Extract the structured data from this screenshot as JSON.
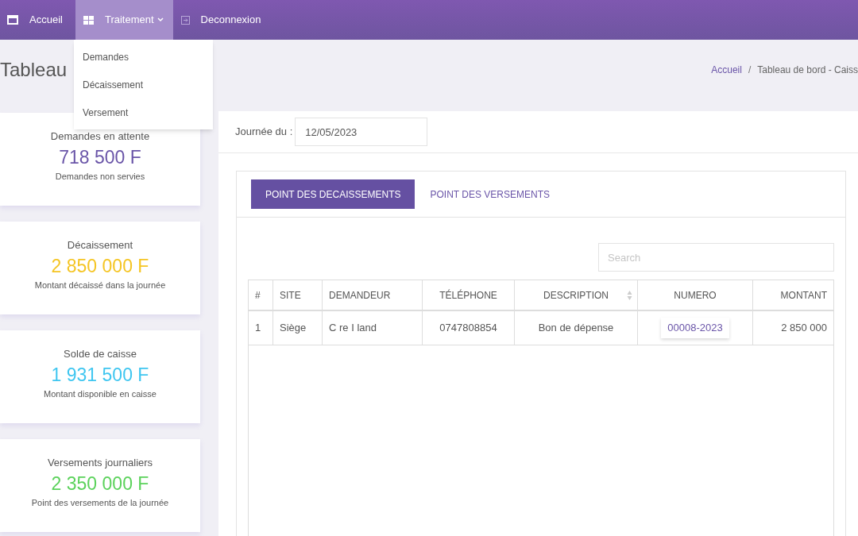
{
  "navbar": {
    "items": [
      {
        "label": "Accueil",
        "selected": false,
        "has_caret": false
      },
      {
        "label": "Traitement",
        "selected": true,
        "has_caret": true
      },
      {
        "label": "Deconnexion",
        "selected": false,
        "has_caret": false
      }
    ]
  },
  "dropdown": {
    "items": [
      "Demandes",
      "Décaissement",
      "Versement"
    ]
  },
  "page_title": "Tableau",
  "breadcrumb": {
    "link": "Accueil",
    "separator": "/",
    "current": "Tableau de bord - Caiss"
  },
  "stats": [
    {
      "title": "Demandes en attente",
      "value": "718 500 F",
      "caption": "Demandes non servies",
      "color": "#6a55a8"
    },
    {
      "title": "Décaissement",
      "value": "2 850 000 F",
      "caption": "Montant décaissé dans la journée",
      "color": "#f5c523"
    },
    {
      "title": "Solde de caisse",
      "value": "1 931 500 F",
      "caption": "Montant disponible en caisse",
      "color": "#3fc6f0"
    },
    {
      "title": "Versements journaliers",
      "value": "2 350 000 F",
      "caption": "Point des versements de la journée",
      "color": "#5bd25b"
    }
  ],
  "date_filter": {
    "label": "Journée du :",
    "value": "12/05/2023"
  },
  "tabs": [
    {
      "label": "POINT DES DECAISSEMENTS",
      "selected": true
    },
    {
      "label": "POINT DES VERSEMENTS",
      "selected": false
    }
  ],
  "search": {
    "placeholder": "Search"
  },
  "table": {
    "columns": [
      {
        "label": "#",
        "sortable": false
      },
      {
        "label": "SITE",
        "sortable": false
      },
      {
        "label": "DEMANDEUR",
        "sortable": false
      },
      {
        "label": "TÉLÉPHONE",
        "sortable": false
      },
      {
        "label": "DESCRIPTION",
        "sortable": true
      },
      {
        "label": "NUMERO",
        "sortable": false
      },
      {
        "label": "MONTANT",
        "sortable": false
      }
    ],
    "rows": [
      {
        "cells": [
          "1",
          "Siège",
          "C re I land",
          "0747808854",
          "Bon de dépense",
          "00008-2023",
          "2 850 000"
        ]
      }
    ]
  }
}
